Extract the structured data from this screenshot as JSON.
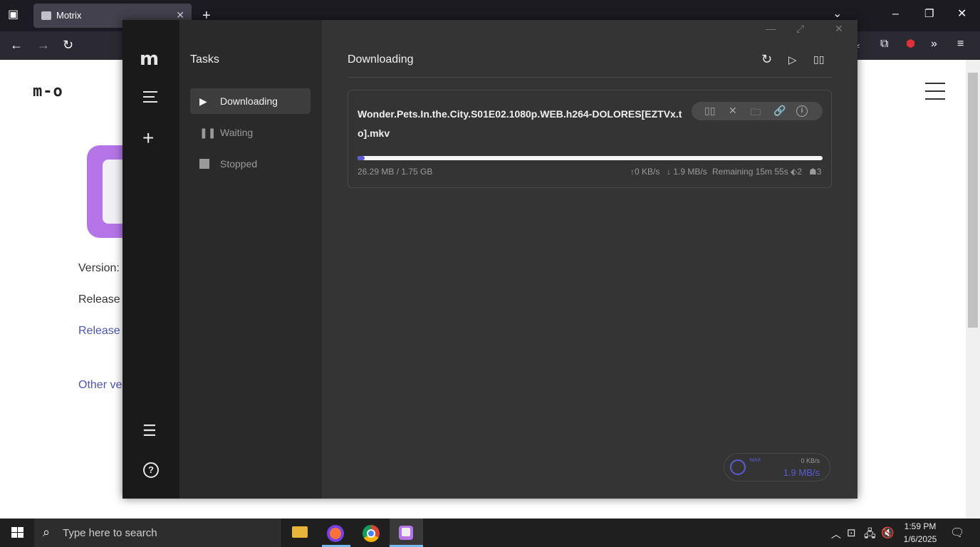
{
  "browser": {
    "tab_title": "Motrix",
    "close_tab_glyph": "✕",
    "new_tab_glyph": "+"
  },
  "page": {
    "logo": "m-o",
    "version_label": "Version:",
    "release_label": "Release d",
    "release_link": "Release n",
    "other_link": "Other ve"
  },
  "motrix": {
    "sidebar_title": "Tasks",
    "filters": [
      {
        "label": "Downloading",
        "active": true,
        "icon": "play-icon"
      },
      {
        "label": "Waiting",
        "active": false,
        "icon": "pause-icon"
      },
      {
        "label": "Stopped",
        "active": false,
        "icon": "stop-icon"
      }
    ],
    "main_title": "Downloading",
    "task": {
      "name": "Wonder.Pets.In.the.City.S01E02.1080p.WEB.h264-DOLORES[EZTVx.to].mkv",
      "progress": 0.015,
      "size": "26.29 MB / 1.75 GB",
      "upload": "0 KB/s",
      "download": "1.9 MB/s",
      "remaining": "Remaining 15m 55s",
      "connections": "2",
      "peers": "3"
    },
    "speedometer": {
      "mode": "MAX",
      "upload": "0 KB/s",
      "download": "1.9 MB/s"
    }
  },
  "taskbar": {
    "search_placeholder": "Type here to search",
    "time": "1:59 PM",
    "date": "1/6/2025"
  },
  "colors": {
    "accent": "#5b5bd6",
    "motrix_bg": "#343434",
    "motrix_nav": "#1a1a1a"
  }
}
